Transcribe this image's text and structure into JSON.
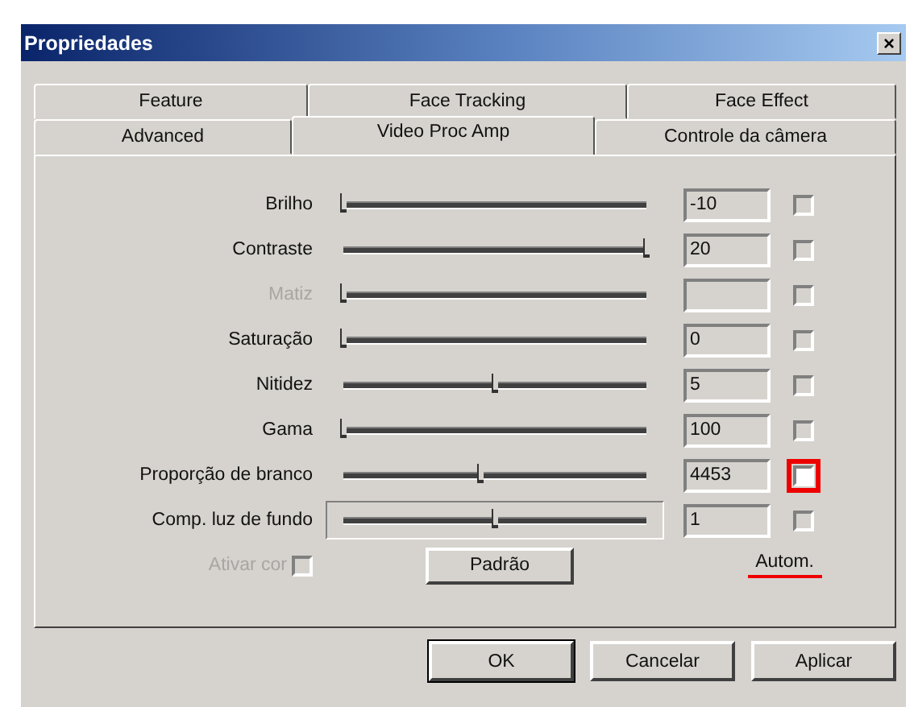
{
  "window": {
    "title": "Propriedades",
    "close": "×"
  },
  "tab_rows": [
    {
      "tabs": [
        {
          "label": "Feature",
          "selected": false
        },
        {
          "label": "Face Tracking",
          "selected": false
        },
        {
          "label": "Face Effect",
          "selected": false
        }
      ]
    },
    {
      "tabs": [
        {
          "label": "Advanced",
          "selected": false
        },
        {
          "label": "Video Proc Amp",
          "selected": true
        },
        {
          "label": "Controle da câmera",
          "selected": false
        }
      ]
    }
  ],
  "controls": [
    {
      "label": "Brilho",
      "disabled": false,
      "level": 0,
      "value": "-10",
      "checked": false,
      "highlighted": false,
      "focused": false
    },
    {
      "label": "Contraste",
      "disabled": false,
      "level": 1,
      "value": "20",
      "checked": false,
      "highlighted": false,
      "focused": false
    },
    {
      "label": "Matiz",
      "disabled": true,
      "level": 0,
      "checked": false,
      "highlighted": false,
      "focused": false
    },
    {
      "label": "Saturação",
      "disabled": false,
      "level": 0,
      "value": "0",
      "checked": false,
      "highlighted": false,
      "focused": false
    },
    {
      "label": "Nitidez",
      "disabled": false,
      "level": 0.5,
      "value": "5",
      "checked": false,
      "highlighted": false,
      "focused": false
    },
    {
      "label": "Gama",
      "disabled": false,
      "level": 0,
      "value": "100",
      "checked": false,
      "highlighted": false,
      "focused": false
    },
    {
      "label": "Proporção de branco",
      "disabled": false,
      "level": 0.45,
      "value": "4453",
      "checked": false,
      "highlighted": true,
      "focused": false
    },
    {
      "label": "Comp. luz de fundo",
      "disabled": false,
      "level": 0.5,
      "value": "1",
      "checked": false,
      "highlighted": false,
      "focused": true
    }
  ],
  "color_enable": {
    "label": "Ativar cor",
    "disabled": true,
    "checked": false
  },
  "default_button": "Padrão",
  "auto_label": {
    "text": "Autom.",
    "highlighted": true
  },
  "buttons": [
    "OK",
    "Cancelar",
    "Aplicar"
  ]
}
